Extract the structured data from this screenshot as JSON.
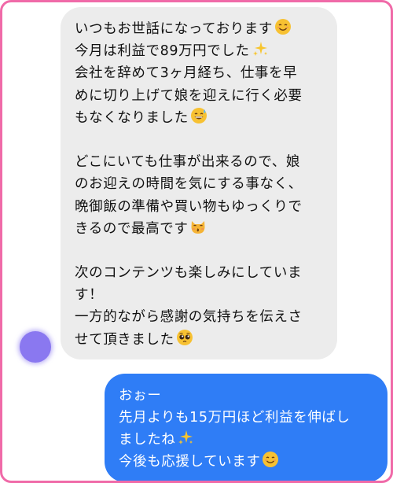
{
  "chat": {
    "incoming": {
      "lines": [
        "いつもお世話になっております",
        "今月は利益で89万円でした",
        "会社を辞めて3ヶ月経ち、仕事を早",
        "めに切り上げて娘を迎えに行く必要",
        "もなくなりました",
        "",
        "どこにいても仕事が出来るので、娘",
        "のお迎えの時間を気にする事なく、",
        "晩御飯の準備や買い物もゆっくりで",
        "きるので最高です",
        "",
        "次のコンテンツも楽しみにしていま",
        "す！",
        "一方的ながら感謝の気持ちを伝えさ",
        "せて頂きました"
      ]
    },
    "outgoing": {
      "lines": [
        "おぉー",
        "先月よりも15万円ほど利益を伸ばし",
        "ましたね",
        "今後も応援しています"
      ]
    },
    "icons": {
      "smiling": "smiling-face-icon",
      "sparkles": "sparkles-icon",
      "sweat_smile": "grinning-sweat-icon",
      "kissing_cat": "kissing-cat-icon",
      "pleading": "pleading-face-icon"
    },
    "colors": {
      "incoming_bubble": "#ececec",
      "outgoing_bubble": "#2f7df6",
      "frame_border": "#f06aa8",
      "avatar": "#8a78f0"
    }
  }
}
